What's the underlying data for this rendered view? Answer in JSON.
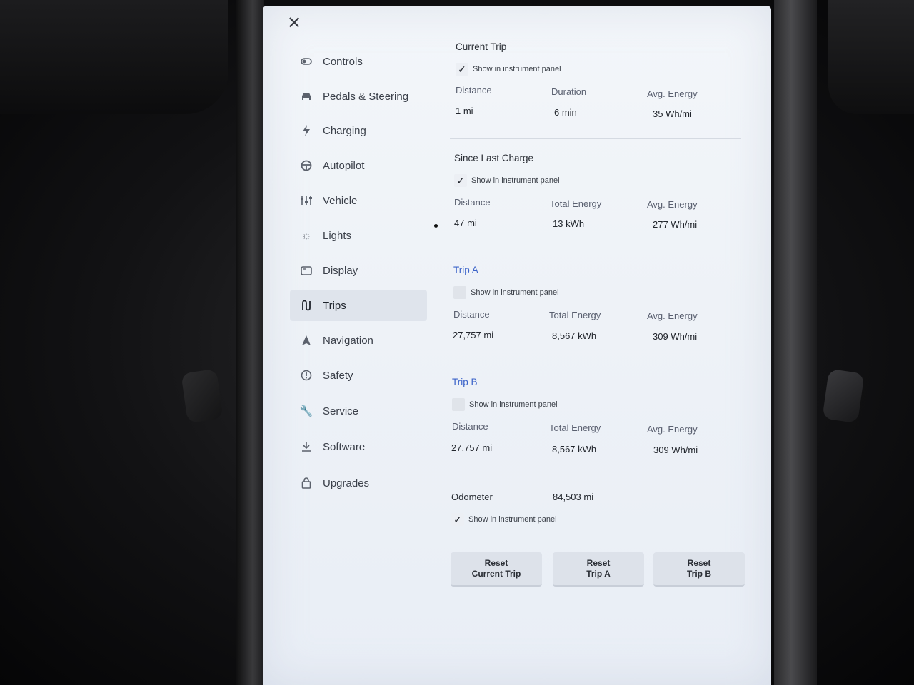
{
  "sidebar": {
    "items": [
      {
        "label": "Controls",
        "icon": "toggle-icon"
      },
      {
        "label": "Pedals & Steering",
        "icon": "car-icon"
      },
      {
        "label": "Charging",
        "icon": "bolt-icon"
      },
      {
        "label": "Autopilot",
        "icon": "steering-wheel-icon"
      },
      {
        "label": "Vehicle",
        "icon": "sliders-icon"
      },
      {
        "label": "Lights",
        "icon": "sun-icon"
      },
      {
        "label": "Display",
        "icon": "display-icon"
      },
      {
        "label": "Trips",
        "icon": "trips-icon",
        "active": true
      },
      {
        "label": "Navigation",
        "icon": "navigation-arrow-icon"
      },
      {
        "label": "Safety",
        "icon": "alert-circle-icon"
      },
      {
        "label": "Service",
        "icon": "wrench-icon"
      },
      {
        "label": "Software",
        "icon": "download-icon"
      },
      {
        "label": "Upgrades",
        "icon": "shopping-bag-icon"
      }
    ]
  },
  "current_trip": {
    "title": "Current Trip",
    "show_label": "Show in instrument panel",
    "checked": true,
    "stats": [
      {
        "label": "Distance",
        "value": "1 mi"
      },
      {
        "label": "Duration",
        "value": "6 min"
      },
      {
        "label": "Avg. Energy",
        "value": "35 Wh/mi"
      }
    ]
  },
  "since_last_charge": {
    "title": "Since Last Charge",
    "show_label": "Show in instrument panel",
    "checked": true,
    "stats": [
      {
        "label": "Distance",
        "value": "47 mi"
      },
      {
        "label": "Total Energy",
        "value": "13 kWh"
      },
      {
        "label": "Avg. Energy",
        "value": "277 Wh/mi"
      }
    ]
  },
  "trip_a": {
    "title": "Trip A",
    "show_label": "Show in instrument panel",
    "checked": false,
    "stats": [
      {
        "label": "Distance",
        "value": "27,757 mi"
      },
      {
        "label": "Total Energy",
        "value": "8,567 kWh"
      },
      {
        "label": "Avg. Energy",
        "value": "309 Wh/mi"
      }
    ]
  },
  "trip_b": {
    "title": "Trip B",
    "show_label": "Show in instrument panel",
    "checked": false,
    "stats": [
      {
        "label": "Distance",
        "value": "27,757 mi"
      },
      {
        "label": "Total Energy",
        "value": "8,567 kWh"
      },
      {
        "label": "Avg. Energy",
        "value": "309 Wh/mi"
      }
    ]
  },
  "odometer": {
    "label": "Odometer",
    "value": "84,503 mi",
    "show_label": "Show in instrument panel",
    "checked": true
  },
  "buttons": {
    "reset_current": {
      "line1": "Reset",
      "line2": "Current Trip"
    },
    "reset_a": {
      "line1": "Reset",
      "line2": "Trip A"
    },
    "reset_b": {
      "line1": "Reset",
      "line2": "Trip B"
    }
  },
  "colors": {
    "accent_blue": "#3b63c9",
    "screen_bg": "#eef2f7"
  }
}
